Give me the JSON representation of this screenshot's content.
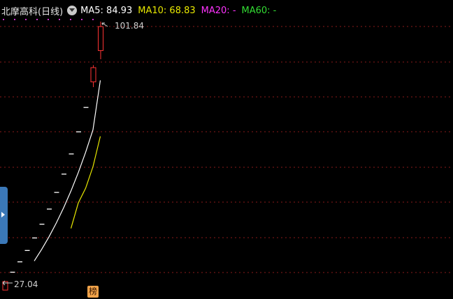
{
  "header": {
    "title": "北摩高科(日线)",
    "ma5": "MA5: 84.93",
    "ma10": "MA10: 68.83",
    "ma20": "MA20: -",
    "ma60": "MA60: -"
  },
  "colors": {
    "background": "#000000",
    "grid": "#8b1a1a",
    "up_candle": "#ff3333",
    "limit_up_dash": "#ffffff",
    "ma5": "#ffffff",
    "ma10": "#e8e800",
    "ma20": "#ff33ff",
    "ma60": "#33dd33"
  },
  "badge_label": "榜",
  "chart_data": {
    "type": "candlestick",
    "ylim": [
      27.04,
      101.84
    ],
    "annotations": {
      "high": "101.84",
      "low": "27.04"
    },
    "candles": [
      {
        "open": 24.6,
        "high": 27.04,
        "low": 24.6,
        "close": 27.04
      },
      {
        "open": 29.74,
        "high": 29.74,
        "low": 29.74,
        "close": 29.74
      },
      {
        "open": 32.72,
        "high": 32.72,
        "low": 32.72,
        "close": 32.72
      },
      {
        "open": 35.99,
        "high": 35.99,
        "low": 35.99,
        "close": 35.99
      },
      {
        "open": 39.59,
        "high": 39.59,
        "low": 39.59,
        "close": 39.59
      },
      {
        "open": 43.55,
        "high": 43.55,
        "low": 43.55,
        "close": 43.55
      },
      {
        "open": 47.9,
        "high": 47.9,
        "low": 47.9,
        "close": 47.9
      },
      {
        "open": 52.69,
        "high": 52.69,
        "low": 52.69,
        "close": 52.69
      },
      {
        "open": 57.96,
        "high": 57.96,
        "low": 57.96,
        "close": 57.96
      },
      {
        "open": 63.76,
        "high": 63.76,
        "low": 63.76,
        "close": 63.76
      },
      {
        "open": 70.13,
        "high": 70.13,
        "low": 70.13,
        "close": 70.13
      },
      {
        "open": 77.14,
        "high": 77.14,
        "low": 77.14,
        "close": 77.14
      },
      {
        "open": 84.5,
        "high": 89.3,
        "low": 83.0,
        "close": 88.6
      },
      {
        "open": 93.5,
        "high": 101.84,
        "low": 91.0,
        "close": 100.4
      }
    ],
    "ma5": [
      null,
      null,
      null,
      null,
      32.97,
      36.27,
      39.89,
      43.88,
      48.27,
      53.1,
      58.41,
      64.25,
      70.72,
      84.93
    ],
    "ma10": [
      null,
      null,
      null,
      null,
      null,
      null,
      null,
      null,
      null,
      42.35,
      49.67,
      53.9,
      60.1,
      68.83
    ]
  }
}
